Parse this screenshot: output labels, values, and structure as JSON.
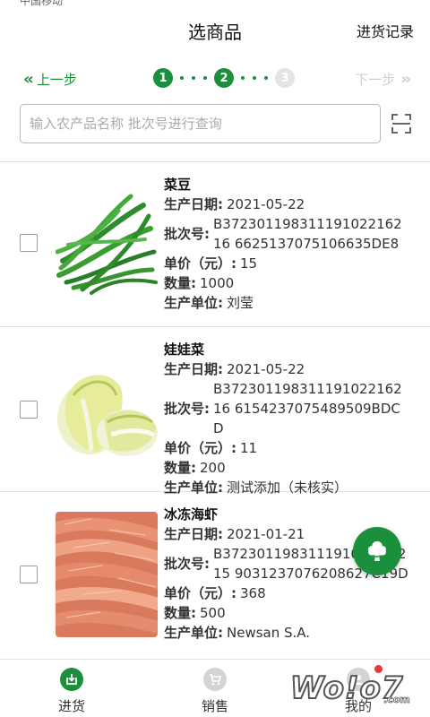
{
  "status_bar": {
    "text": "中国移动"
  },
  "header": {
    "title": "选商品",
    "history_link": "进货记录"
  },
  "stepper": {
    "prev_label": "上一步",
    "next_label": "下一步",
    "steps": [
      "1",
      "2",
      "3"
    ],
    "current_step": 2
  },
  "search": {
    "placeholder": "输入农产品名称 批次号进行查询",
    "value": ""
  },
  "labels": {
    "production_date": "生产日期:",
    "batch_no": "批次号:",
    "unit_price": "单价（元）:",
    "quantity": "数量:",
    "producer": "生产单位:"
  },
  "products": [
    {
      "name": "菜豆",
      "production_date": "2021-05-22",
      "batch_no": "B37230119831119102216216 6625137075106635DE8",
      "unit_price": "15",
      "quantity": "1000",
      "producer": "刘莹",
      "checked": false,
      "image": "green-beans"
    },
    {
      "name": "娃娃菜",
      "production_date": "2021-05-22",
      "batch_no": "B37230119831119102216216 6154237075489509BDCD",
      "unit_price": "11",
      "quantity": "200",
      "producer": "测试添加（未核实）",
      "checked": false,
      "image": "baby-cabbage"
    },
    {
      "name": "冰冻海虾",
      "production_date": "2021-01-21",
      "batch_no": "B372301198311191022 16215 9031237076208627C19D",
      "unit_price": "368",
      "quantity": "500",
      "producer": "Newsan S.A.",
      "checked": false,
      "image": "frozen-shrimp"
    }
  ],
  "tabbar": {
    "tabs": [
      {
        "label": "进货",
        "icon": "purchase-icon",
        "active": true
      },
      {
        "label": "销售",
        "icon": "cart-icon",
        "active": false
      },
      {
        "label": "我的",
        "icon": "profile-icon",
        "active": false
      }
    ]
  },
  "watermark": {
    "text": "Wo!o7",
    "sub": ".com"
  },
  "colors": {
    "primary": "#1a8f3c",
    "disabled": "#cfcfcf",
    "badge": "#e53935"
  }
}
